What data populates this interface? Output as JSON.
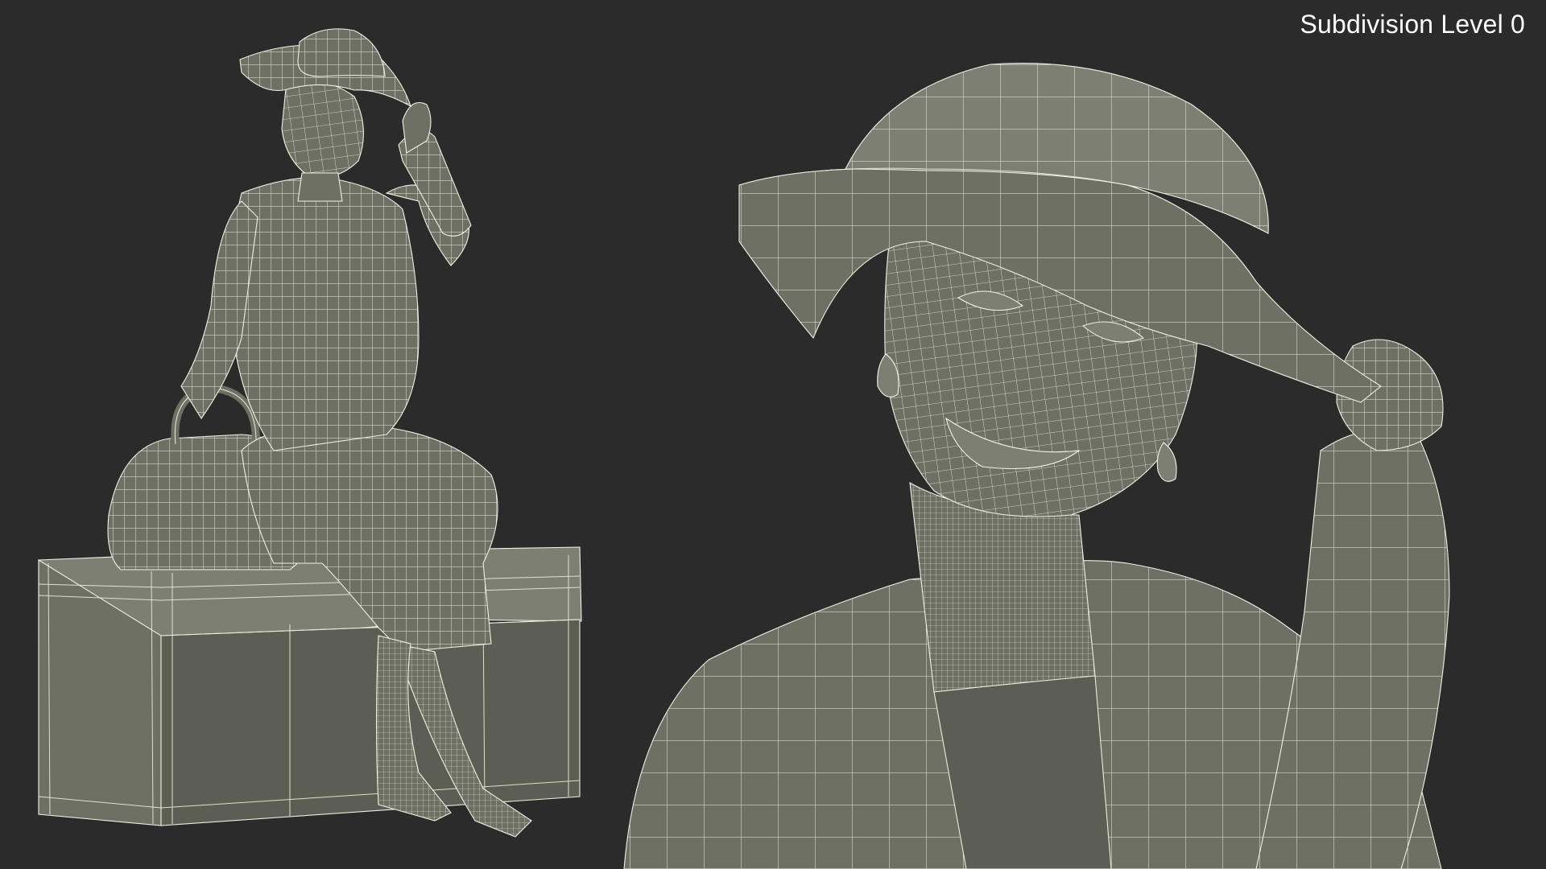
{
  "viewport": {
    "caption": "Subdivision Level 0",
    "background_color": "#2b2b2b",
    "mesh_color": "#6f7064",
    "wire_color": "#f1efe6"
  },
  "views": [
    {
      "name": "full-body-view"
    },
    {
      "name": "close-up-view"
    }
  ]
}
